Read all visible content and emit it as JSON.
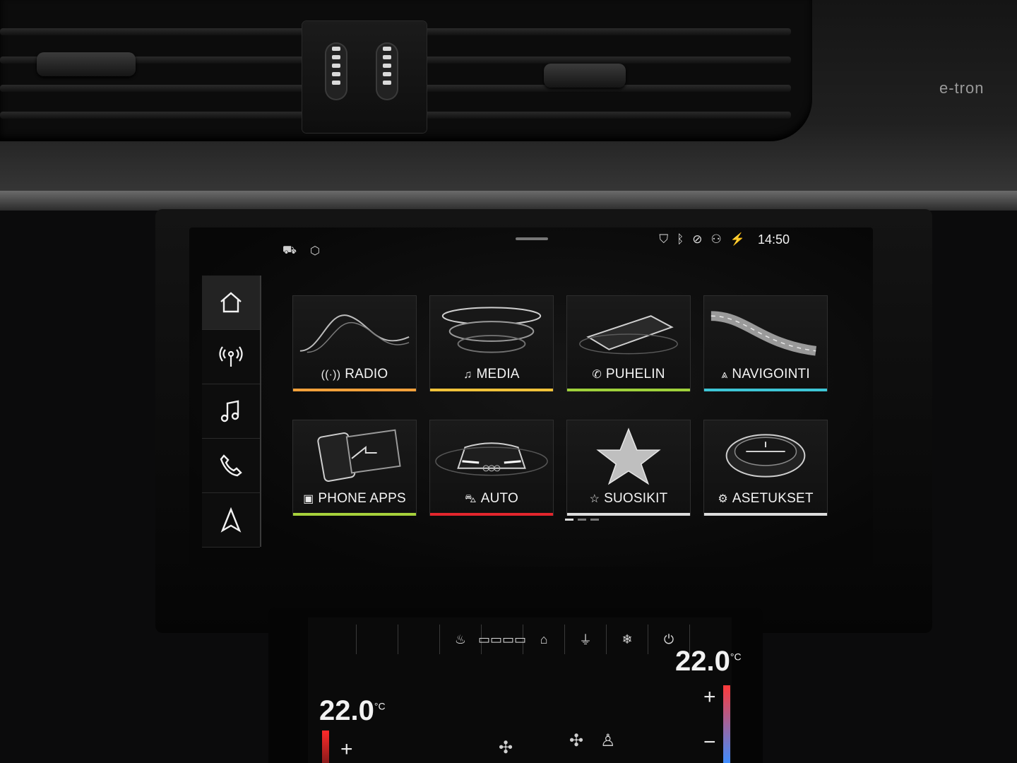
{
  "status": {
    "time": "14:50",
    "icons": [
      "shield-icon",
      "bluetooth-icon",
      "mute-icon",
      "passenger-icon",
      "charging-icon"
    ]
  },
  "top_left_icons": [
    "car-connect-icon",
    "package-icon"
  ],
  "sidebar": {
    "items": [
      {
        "icon": "home-icon",
        "active": true
      },
      {
        "icon": "radio-icon",
        "active": false
      },
      {
        "icon": "music-note-icon",
        "active": false
      },
      {
        "icon": "phone-icon",
        "active": false
      },
      {
        "icon": "navigation-icon",
        "active": false
      }
    ]
  },
  "tiles": [
    {
      "label": "RADIO",
      "glyph": "((·))",
      "icon": "radio-icon",
      "accent": "#f2a13b"
    },
    {
      "label": "MEDIA",
      "glyph": "♫",
      "icon": "music-note-icon",
      "accent": "#f0c23a"
    },
    {
      "label": "PUHELIN",
      "glyph": "✆",
      "icon": "phone-icon",
      "accent": "#9fd13b"
    },
    {
      "label": "NAVIGOINTI",
      "glyph": "⩓",
      "icon": "navigation-icon",
      "accent": "#3ec6d6"
    },
    {
      "label": "PHONE APPS",
      "glyph": "▣",
      "icon": "phone-apps-icon",
      "accent": "#a6d13b"
    },
    {
      "label": "AUTO",
      "glyph": "⛍",
      "icon": "car-icon",
      "accent": "#e2262d"
    },
    {
      "label": "SUOSIKIT",
      "glyph": "☆",
      "icon": "star-icon",
      "accent": "#dcdcdc"
    },
    {
      "label": "ASETUKSET",
      "glyph": "⚙",
      "icon": "gear-icon",
      "accent": "#dcdcdc"
    }
  ],
  "page_indicator": {
    "count": 3,
    "current": 1
  },
  "brand_badge": "e-tron",
  "climate": {
    "temp_left": "22.0",
    "temp_right": "22.0",
    "unit": "°C",
    "plus": "+",
    "minus": "−",
    "buttons": [
      "",
      "",
      "",
      "",
      "seat-heat-icon",
      "▭▭▭▭",
      "home-air-icon",
      "plug-icon",
      "defrost-off-icon",
      "power-icon"
    ]
  },
  "colors": {
    "screen_bg": "#0a0a0a",
    "text": "#f4f4f4"
  }
}
